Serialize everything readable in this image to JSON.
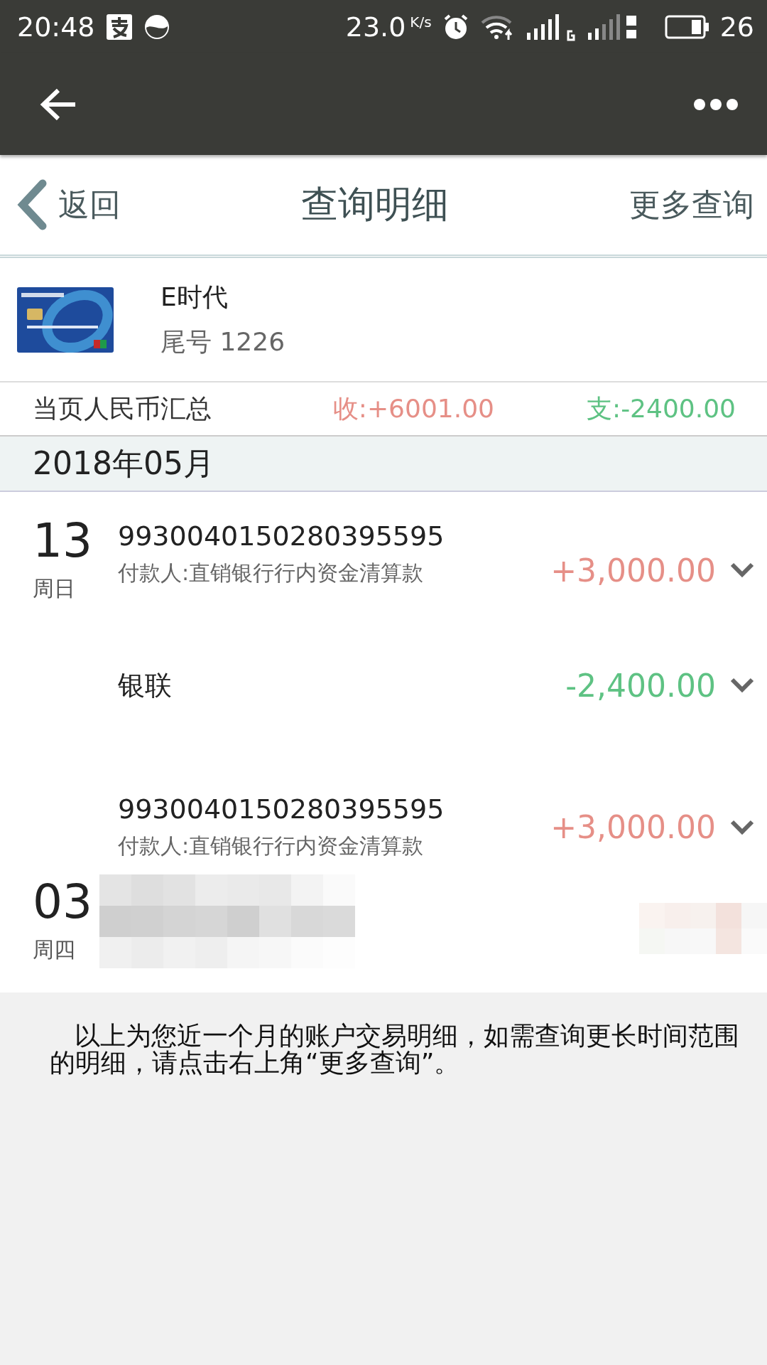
{
  "status_bar": {
    "time": "20:48",
    "speed": "23.0",
    "speed_unit": "K/s",
    "battery": "26"
  },
  "header": {
    "back": "返回",
    "title": "查询明细",
    "more": "更多查询"
  },
  "account": {
    "name": "E时代",
    "tail": "尾号 1226"
  },
  "summary": {
    "label": "当页人民币汇总",
    "income": "收:+6001.00",
    "expense": "支:-2400.00"
  },
  "month": "2018年05月",
  "transactions": [
    {
      "day": "13",
      "weekday": "周日",
      "title": "9930040150280395595",
      "subtitle": "付款人:直销银行行内资金清算款",
      "amount": "+3,000.00",
      "kind": "income"
    },
    {
      "title": "银联",
      "amount": "-2,400.00",
      "kind": "expense"
    },
    {
      "title": "9930040150280395595",
      "subtitle": "付款人:直销银行行内资金清算款",
      "amount": "+3,000.00",
      "kind": "income"
    },
    {
      "day": "03",
      "weekday": "周四",
      "kind": "redacted"
    }
  ],
  "note": "以上为您近一个月的账户交易明细，如需查询更长时间范围的明细，请点击右上角“更多查询”。"
}
